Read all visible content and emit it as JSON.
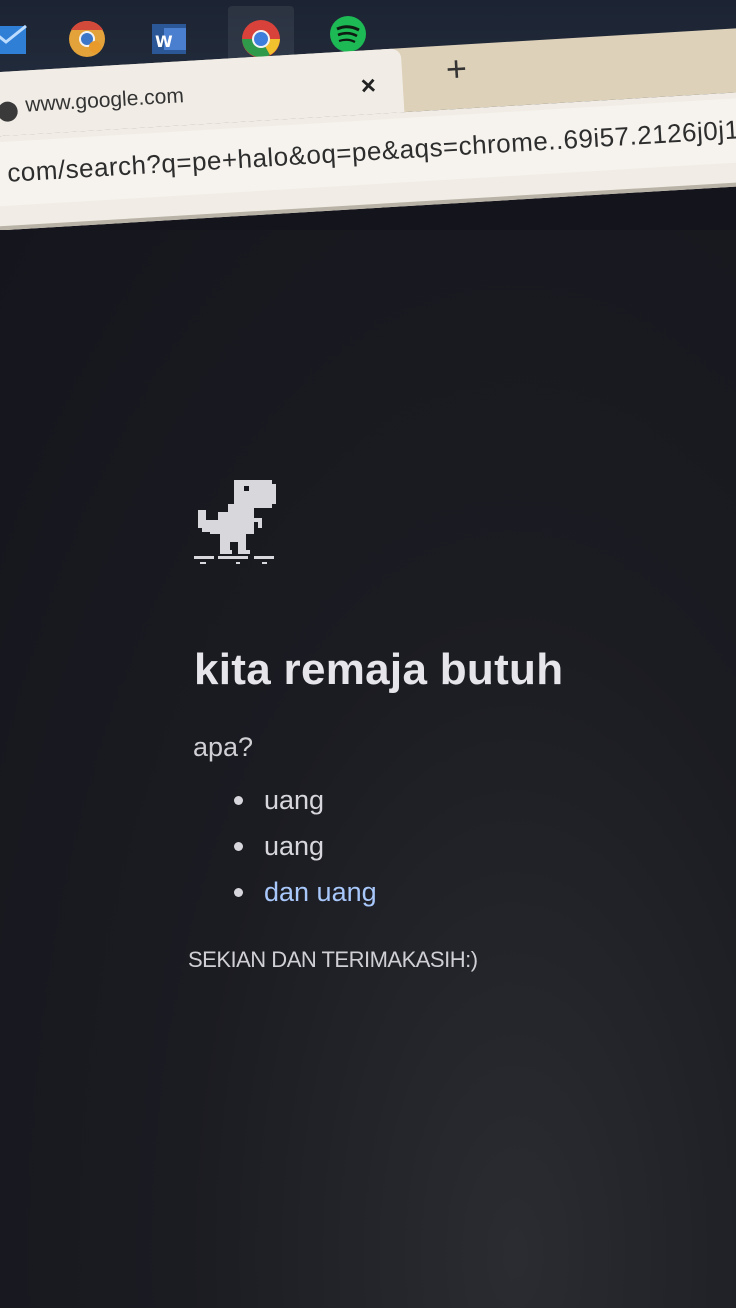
{
  "taskbar": {
    "icons": [
      "mail-icon",
      "chrome-canary-icon",
      "word-icon",
      "chrome-icon",
      "spotify-icon"
    ]
  },
  "browser": {
    "tab": {
      "title": "www.google.com",
      "close_label": "×"
    },
    "new_tab_label": "+",
    "address_bar": {
      "url": "com/search?q=pe+halo&oq=pe&aqs=chrome..69i57.2126j0j1"
    }
  },
  "page": {
    "headline": "kita remaja butuh",
    "subheading": "apa?",
    "items": [
      {
        "text": "uang"
      },
      {
        "text": "uang"
      },
      {
        "text": "dan uang"
      }
    ],
    "footer": "SEKIAN DAN TERIMAKASIH:)"
  },
  "colors": {
    "page_background": "#15151d",
    "text": "#e6e6ea",
    "link": "#a8c7fa",
    "tab_strip": "#ddd1b9",
    "toolbar": "#f1ede6"
  }
}
